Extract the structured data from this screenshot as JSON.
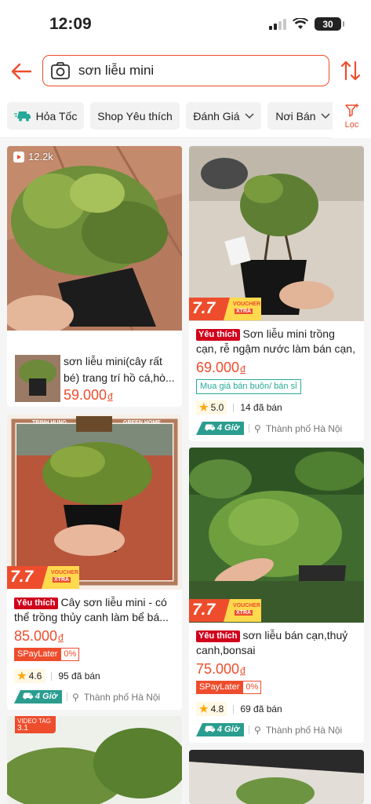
{
  "status_bar": {
    "time": "12:09",
    "battery": "30"
  },
  "search": {
    "query": "sơn liễu mini"
  },
  "filters": {
    "chips": [
      "Hỏa Tốc",
      "Shop Yêu thích",
      "Đánh Giá",
      "Nơi Bán"
    ],
    "filter_label": "Lọc"
  },
  "colors": {
    "accent": "#ee4d2d",
    "teal": "#26aa99",
    "tag_red": "#d0011b"
  },
  "products": [
    {
      "views": "12.2k",
      "title": "sơn liễu mini(cây rất bé) trang trí hồ cá,hò...",
      "price": "59.000",
      "currency": "đ"
    },
    {
      "tag": "Yêu thích",
      "title": "Sơn liễu mini trồng cạn, rễ ngậm nước làm bán cạn, tiể...",
      "price": "69.000",
      "currency": "đ",
      "wholesale": "Mua giá bán buôn/ bán sỉ",
      "rating": "5.0",
      "sold": "14 đã bán",
      "delivery": "4 Giờ",
      "location": "Thành phố Hà Nội"
    },
    {
      "tag": "Yêu thích",
      "title": "Cây sơn liễu mini - có thể trồng thủy canh làm bể bá...",
      "price": "85.000",
      "currency": "đ",
      "spay": "SPayLater",
      "spay_rate": "0%",
      "rating": "4.6",
      "sold": "95 đã bán",
      "delivery": "4 Giờ",
      "location": "Thành phố Hà Nội"
    },
    {
      "tag": "Yêu thích",
      "title": "sơn liễu bán cạn,thuỷ canh,bonsai",
      "price": "75.000",
      "currency": "đ",
      "spay": "SPayLater",
      "spay_rate": "0%",
      "rating": "4.8",
      "sold": "69 đã bán",
      "delivery": "4 Giờ",
      "location": "Thành phố Hà Nội"
    },
    {
      "video_tag": "VIDEO TAG",
      "views": "3.1"
    },
    {}
  ],
  "promo": {
    "big": "7.7",
    "voucher": "VOUCHER",
    "xtra": "XTRA"
  },
  "shop_banner": {
    "left": "TRINH HUNG",
    "right": "GREEN HOME"
  }
}
